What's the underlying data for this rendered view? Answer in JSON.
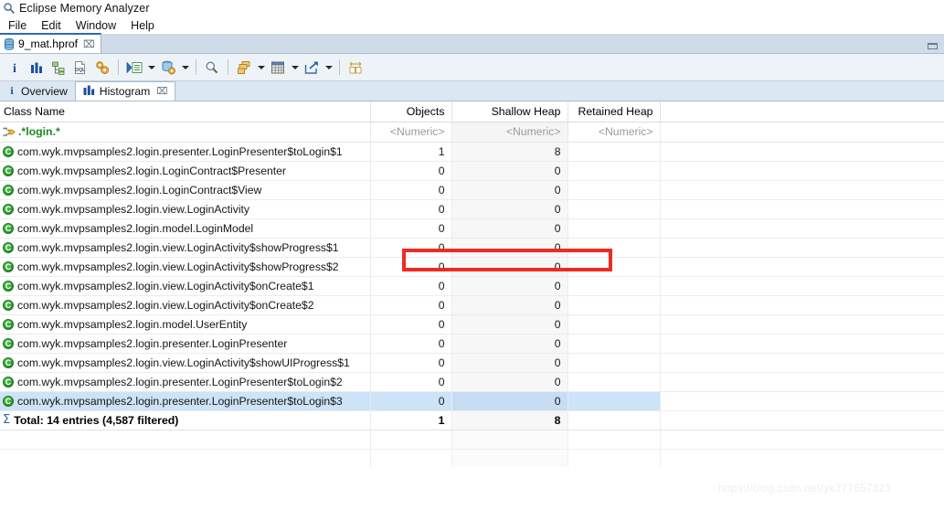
{
  "window": {
    "title": "Eclipse Memory Analyzer",
    "app_icon": "memory-analyzer-icon",
    "minimize_label": "▭"
  },
  "menu": {
    "items": [
      {
        "label": "File"
      },
      {
        "label": "Edit"
      },
      {
        "label": "Window"
      },
      {
        "label": "Help"
      }
    ]
  },
  "editor_tabs": [
    {
      "label": "9_mat.hprof",
      "icon": "heap-dump-icon",
      "close": "⌧",
      "active": true
    }
  ],
  "toolbar": {
    "items": [
      {
        "name": "info-icon",
        "glyph": "i"
      },
      {
        "name": "histogram-icon",
        "glyph": "bars"
      },
      {
        "name": "dominator-tree-icon",
        "glyph": "tree"
      },
      {
        "name": "oql-icon",
        "glyph": "OQL"
      },
      {
        "name": "groups-gear-icon",
        "glyph": "gear"
      },
      {
        "name": "run-expert-system-icon",
        "glyph": "run"
      },
      {
        "name": "run-expert-dropdown",
        "glyph": "caret"
      },
      {
        "name": "query-browser-icon",
        "glyph": "db-gear"
      },
      {
        "name": "query-browser-dropdown",
        "glyph": "caret"
      },
      {
        "name": "search-icon",
        "glyph": "magnifier"
      },
      {
        "name": "group-by-icon",
        "glyph": "stack"
      },
      {
        "name": "group-by-dropdown",
        "glyph": "caret"
      },
      {
        "name": "calculate-icon",
        "glyph": "grid"
      },
      {
        "name": "calculate-dropdown",
        "glyph": "caret"
      },
      {
        "name": "export-icon",
        "glyph": "export"
      },
      {
        "name": "export-dropdown",
        "glyph": "caret"
      },
      {
        "name": "fit-columns-icon",
        "glyph": "fit"
      }
    ]
  },
  "view_tabs": [
    {
      "label": "Overview",
      "icon": "info-icon",
      "active": false,
      "close": ""
    },
    {
      "label": "Histogram",
      "icon": "histogram-icon",
      "active": true,
      "close": "⌧"
    }
  ],
  "table": {
    "columns": [
      {
        "key": "class_name",
        "label": "Class Name",
        "align": "left"
      },
      {
        "key": "objects",
        "label": "Objects",
        "align": "right"
      },
      {
        "key": "shallow_heap",
        "label": "Shallow Heap",
        "align": "right",
        "sorted": true,
        "sort_dir": "desc"
      },
      {
        "key": "retained_heap",
        "label": "Retained Heap",
        "align": "right"
      }
    ],
    "filter_row": {
      "class_name": ".*login.*",
      "objects": "<Numeric>",
      "shallow_heap": "<Numeric>",
      "retained_heap": "<Numeric>",
      "filter_icon": "filter-arrow-icon"
    },
    "rows": [
      {
        "class_name": "com.wyk.mvpsamples2.login.presenter.LoginPresenter$toLogin$1",
        "objects": "1",
        "shallow_heap": "8",
        "retained_heap": "",
        "selected": false
      },
      {
        "class_name": "com.wyk.mvpsamples2.login.LoginContract$Presenter",
        "objects": "0",
        "shallow_heap": "0",
        "retained_heap": "",
        "selected": false
      },
      {
        "class_name": "com.wyk.mvpsamples2.login.LoginContract$View",
        "objects": "0",
        "shallow_heap": "0",
        "retained_heap": "",
        "selected": false
      },
      {
        "class_name": "com.wyk.mvpsamples2.login.view.LoginActivity",
        "objects": "0",
        "shallow_heap": "0",
        "retained_heap": "",
        "selected": false
      },
      {
        "class_name": "com.wyk.mvpsamples2.login.model.LoginModel",
        "objects": "0",
        "shallow_heap": "0",
        "retained_heap": "",
        "selected": false
      },
      {
        "class_name": "com.wyk.mvpsamples2.login.view.LoginActivity$showProgress$1",
        "objects": "0",
        "shallow_heap": "0",
        "retained_heap": "",
        "selected": false
      },
      {
        "class_name": "com.wyk.mvpsamples2.login.view.LoginActivity$showProgress$2",
        "objects": "0",
        "shallow_heap": "0",
        "retained_heap": "",
        "selected": false
      },
      {
        "class_name": "com.wyk.mvpsamples2.login.view.LoginActivity$onCreate$1",
        "objects": "0",
        "shallow_heap": "0",
        "retained_heap": "",
        "selected": false
      },
      {
        "class_name": "com.wyk.mvpsamples2.login.view.LoginActivity$onCreate$2",
        "objects": "0",
        "shallow_heap": "0",
        "retained_heap": "",
        "selected": false
      },
      {
        "class_name": "com.wyk.mvpsamples2.login.model.UserEntity",
        "objects": "0",
        "shallow_heap": "0",
        "retained_heap": "",
        "selected": false
      },
      {
        "class_name": "com.wyk.mvpsamples2.login.presenter.LoginPresenter",
        "objects": "0",
        "shallow_heap": "0",
        "retained_heap": "",
        "selected": false
      },
      {
        "class_name": "com.wyk.mvpsamples2.login.view.LoginActivity$showUIProgress$1",
        "objects": "0",
        "shallow_heap": "0",
        "retained_heap": "",
        "selected": false
      },
      {
        "class_name": "com.wyk.mvpsamples2.login.presenter.LoginPresenter$toLogin$2",
        "objects": "0",
        "shallow_heap": "0",
        "retained_heap": "",
        "selected": false
      },
      {
        "class_name": "com.wyk.mvpsamples2.login.presenter.LoginPresenter$toLogin$3",
        "objects": "0",
        "shallow_heap": "0",
        "retained_heap": "",
        "selected": true
      }
    ],
    "total_row": {
      "label": "Total: 14 entries (4,587 filtered)",
      "objects": "1",
      "shallow_heap": "8",
      "retained_heap": "",
      "icon": "sigma-icon",
      "sigma": "Σ"
    }
  },
  "annotation": {
    "name": "red-highlight-rectangle",
    "color": "#ee2b22"
  },
  "watermark": {
    "text": "https://blog.csdn.net/yk377657321"
  },
  "colors": {
    "accent": "#2b6cb5",
    "tab_bg": "#cfdce8",
    "toolbar_bg": "#eef3f8",
    "selection": "#cde3f7",
    "filter_expr": "#1f8a1f",
    "annotation": "#ee2b22"
  }
}
